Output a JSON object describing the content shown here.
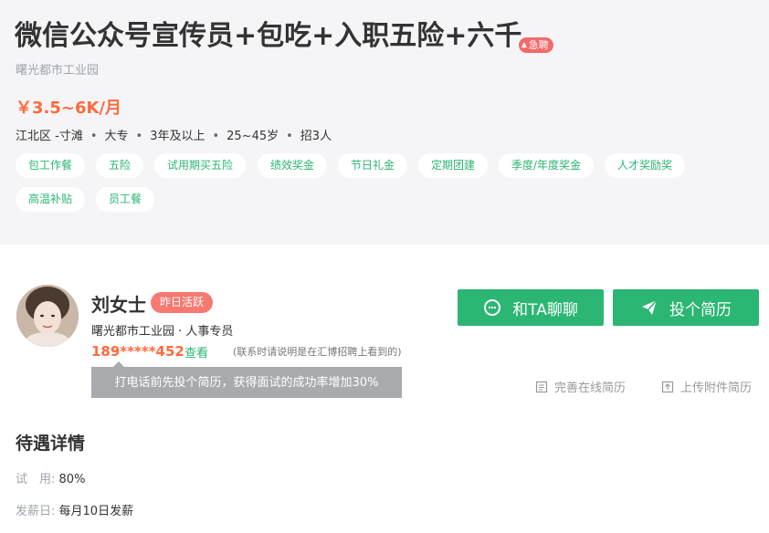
{
  "job": {
    "title": "微信公众号宣传员+包吃+入职五险+六千",
    "urgent_label": "急聘",
    "company": "曙光都市工业园",
    "salary": "￥3.5~6K/月",
    "meta": [
      "江北区 -寸滩",
      "大专",
      "3年及以上",
      "25~45岁",
      "招3人"
    ],
    "tags": [
      "包工作餐",
      "五险",
      "试用期买五险",
      "绩效奖金",
      "节日礼金",
      "定期团建",
      "季度/年度奖金",
      "人才奖励奖",
      "高温补贴",
      "员工餐"
    ]
  },
  "recruiter": {
    "name": "刘女士",
    "active_badge": "昨日活跃",
    "role": "曙光都市工业园 · 人事专员",
    "phone": "189*****452",
    "view_label": "查看",
    "note": "(联系时请说明是在汇博招聘上看到的)",
    "tip": "打电话前先投个简历，获得面试的成功率增加30%"
  },
  "actions": {
    "chat_label": "和TA聊聊",
    "resume_label": "投个简历",
    "complete_resume": "完善在线简历",
    "upload_resume": "上传附件简历"
  },
  "benefits": {
    "title": "待遇详情",
    "rows": [
      {
        "label": "试　用:",
        "value": "80%"
      },
      {
        "label": "发薪日:",
        "value": "每月10日发薪"
      }
    ]
  },
  "colors": {
    "accent_green": "#2bb673",
    "salary_orange": "#ff6a3d",
    "badge_red": "#f47a72"
  }
}
